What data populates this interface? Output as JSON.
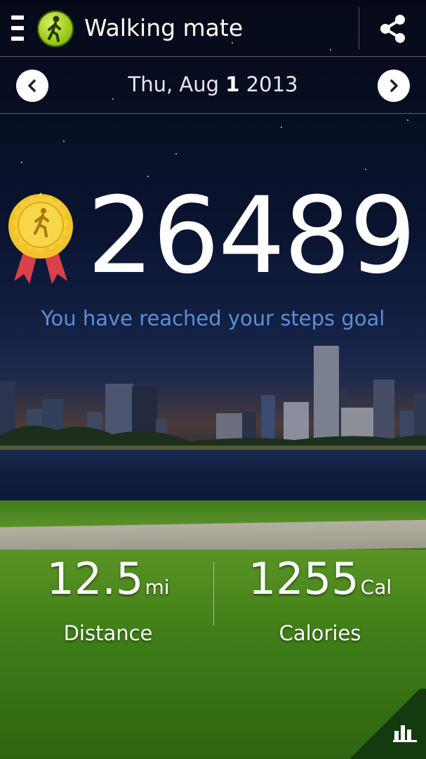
{
  "app": {
    "title": "Walking mate",
    "icons": {
      "menu": "menu-icon",
      "logo": "walking-person-icon",
      "share": "share-icon",
      "chart": "bar-chart-icon"
    }
  },
  "date": {
    "weekday_month": "Thu, Aug ",
    "day": "1",
    "year": " 2013",
    "prev_icon": "chevron-left-icon",
    "next_icon": "chevron-right-icon"
  },
  "steps": {
    "count": "26489",
    "message": "You have reached your steps goal",
    "medal_icon": "goal-medal-icon"
  },
  "stats": {
    "distance": {
      "value": "12.5",
      "unit": "mi",
      "label": "Distance"
    },
    "calories": {
      "value": "1255",
      "unit": "Cal",
      "label": "Calories"
    }
  },
  "colors": {
    "accent": "#5b8fd6",
    "logo_green": "#9ccc1a",
    "medal_gold": "#f2c22c",
    "ribbon_red": "#d8404a"
  }
}
